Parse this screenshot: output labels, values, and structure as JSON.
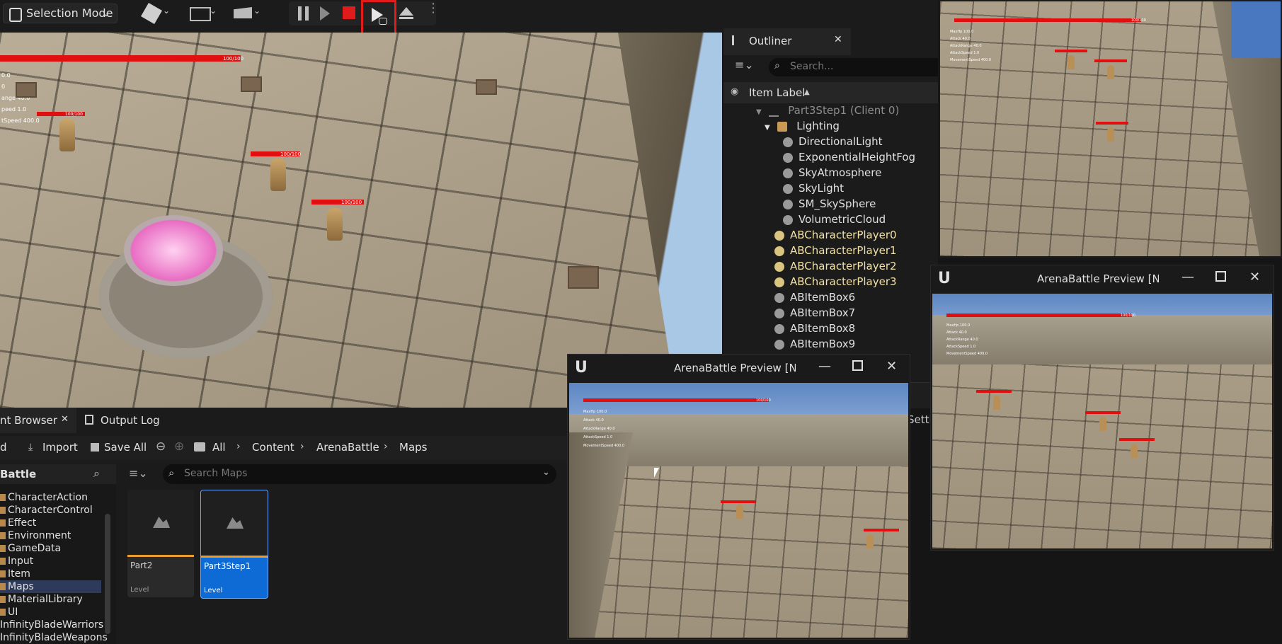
{
  "toolbar": {
    "mode_label": "Selection Mode"
  },
  "viewport": {
    "main_hp_label": "100/100",
    "char_hp_labels": [
      "100/100",
      "100/100",
      "100/100"
    ],
    "stats": [
      "0.0",
      "0",
      "ange 40.0",
      "peed 1.0",
      "tSpeed 400.0"
    ]
  },
  "outliner": {
    "tab_label": "Outliner",
    "search_placeholder": "Search...",
    "column_header": "Item Label",
    "sort_glyph": "▲",
    "root_label": "Part3Step1 (Client 0)",
    "folder_label": "Lighting",
    "items": [
      {
        "label": "DirectionalLight"
      },
      {
        "label": "ExponentialHeightFog"
      },
      {
        "label": "SkyAtmosphere"
      },
      {
        "label": "SkyLight"
      },
      {
        "label": "SM_SkySphere"
      },
      {
        "label": "VolumetricCloud"
      },
      {
        "label": "ABCharacterPlayer0"
      },
      {
        "label": "ABCharacterPlayer1"
      },
      {
        "label": "ABCharacterPlayer2"
      },
      {
        "label": "ABCharacterPlayer3"
      },
      {
        "label": "ABItemBox6"
      },
      {
        "label": "ABItemBox7"
      },
      {
        "label": "ABItemBox8"
      },
      {
        "label": "ABItemBox9"
      }
    ]
  },
  "content_browser": {
    "tab_label": "nt Browser",
    "tab2_label": "Output Log",
    "add_label": "d",
    "import_label": "Import",
    "save_all_label": "Save All",
    "breadcrumb": [
      "All",
      "Content",
      "ArenaBattle",
      "Maps"
    ],
    "tree_header": "Battle",
    "tree_items": [
      "CharacterAction",
      "CharacterControl",
      "Effect",
      "Environment",
      "GameData",
      "Input",
      "Item",
      "Maps",
      "MaterialLibrary",
      "UI",
      "InfinityBladeWarriors",
      "InfinityBladeWeapons"
    ],
    "search_placeholder": "Search Maps",
    "assets": [
      {
        "name": "Part2",
        "type": "Level"
      },
      {
        "name": "Part3Step1",
        "type": "Level"
      }
    ],
    "settings_peek": "Setti"
  },
  "preview_windows": [
    {
      "title": "ArenaBattle Preview [NetMo",
      "hp_label": "100/100"
    },
    {
      "title": "ArenaBattle Preview [NetMo",
      "hp_label": "100/100"
    }
  ],
  "preview_stats": [
    "MaxHp 100.0",
    "Attack 40.0",
    "AttackRange 40.0",
    "AttackSpeed 1.0",
    "MovementSpeed 400.0"
  ],
  "colors": {
    "accent_highlight": "#e41b1b",
    "selected_blue": "#0e6bd6",
    "hp_red": "#e01010",
    "player_yellow": "#f2e2a8"
  }
}
